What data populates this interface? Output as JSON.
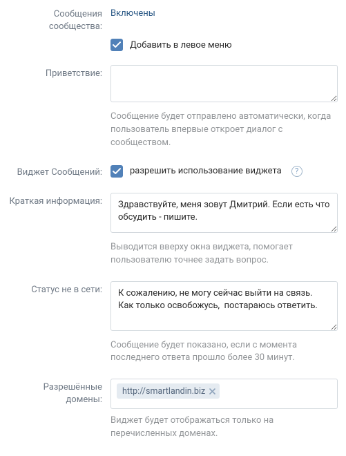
{
  "messages": {
    "label": "Сообщения сообщества:",
    "value": "Включены",
    "add_to_menu_label": "Добавить в левое меню"
  },
  "greeting": {
    "label": "Приветствие:",
    "value": "",
    "hint": "Сообщение будет отправлено автоматически, когда пользователь впервые откроет диалог с сообществом."
  },
  "widget": {
    "label": "Виджет Сообщений:",
    "allow_label": "разрешить использование виджета"
  },
  "short_info": {
    "label": "Краткая информация:",
    "value": "Здравствуйте, меня зовут Дмитрий. Если есть что обсудить - пишите.",
    "hint": "Выводится вверху окна виджета, помогает пользователю точнее задать вопрос."
  },
  "offline_status": {
    "label": "Статус не в сети:",
    "value": "К сожалению, не могу сейчас выйти на связь. Как только освобожусь,  постараюсь ответить.",
    "hint": "Сообщение будет показано, если с момента последнего ответа прошло более 30 минут."
  },
  "allowed_domains": {
    "label": "Разрешённые домены:",
    "token": "http://smartlandin.biz",
    "hint": "Виджет будет отображаться только на перечисленных доменах."
  }
}
